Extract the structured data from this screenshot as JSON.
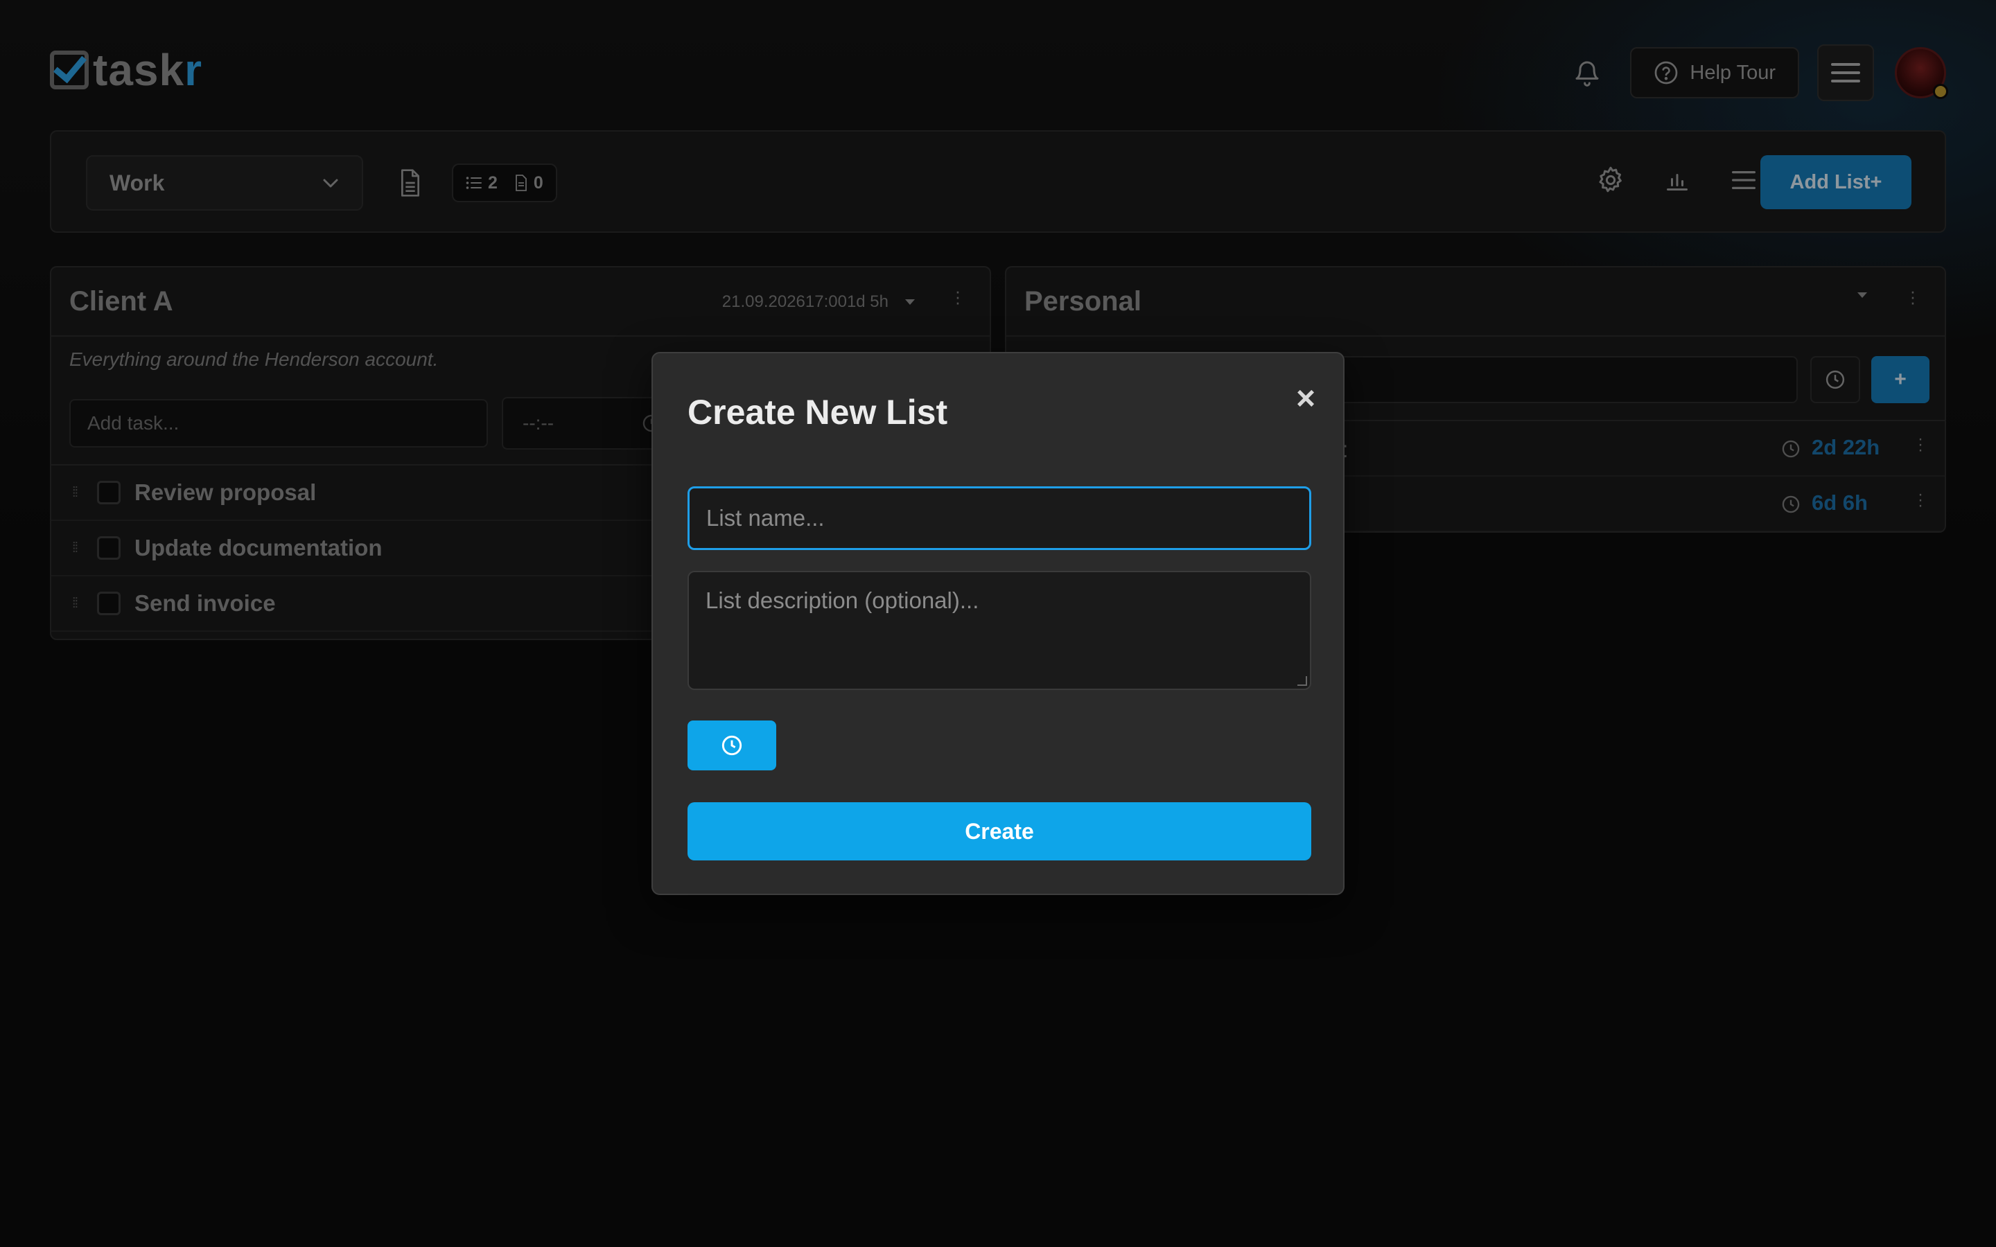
{
  "app": {
    "logo_main": "task",
    "logo_accent": "r"
  },
  "header": {
    "help_label": "Help Tour"
  },
  "toolbar": {
    "workspace": "Work",
    "list_count": "2",
    "doc_count": "0",
    "add_list_label": "Add List+"
  },
  "lists": [
    {
      "title": "Client A",
      "due": "21.09.202617:001d 5h",
      "description": "Everything around the Henderson account.",
      "add_placeholder": "Add task...",
      "time_placeholder": "--:--",
      "tasks": [
        {
          "label": "Review proposal"
        },
        {
          "label": "Update documentation"
        },
        {
          "label": "Send invoice"
        }
      ]
    },
    {
      "title": "Personal",
      "add_button": "+",
      "tasks": [
        {
          "label_fragment": "nt",
          "due": "2d 22h"
        },
        {
          "label_fragment": "o",
          "due": "6d 6h"
        }
      ]
    }
  ],
  "modal": {
    "title": "Create New List",
    "close": "×",
    "name_placeholder": "List name...",
    "description_placeholder": "List description (optional)...",
    "create_label": "Create"
  },
  "colors": {
    "accent": "#0ea5e9",
    "accent_dim": "#1478b4",
    "background": "#0b0b0b",
    "modal_bg": "#2b2b2b"
  },
  "icons": [
    "bell-icon",
    "help-circle-icon",
    "hamburger-icon",
    "chevron-down-icon",
    "document-icon",
    "list-icon",
    "gear-icon",
    "bar-chart-icon",
    "clock-icon",
    "kebab-icon",
    "grip-icon",
    "close-icon"
  ]
}
